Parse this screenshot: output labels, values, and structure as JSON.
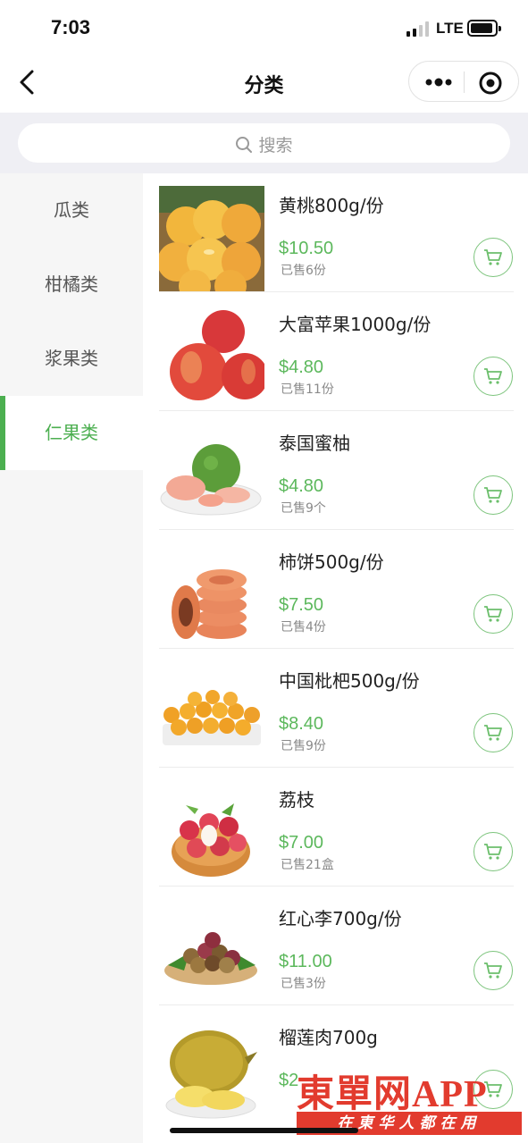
{
  "status_bar": {
    "time": "7:03",
    "network": "LTE"
  },
  "navbar": {
    "title": "分类"
  },
  "search": {
    "placeholder": "搜索"
  },
  "sidebar": {
    "items": [
      {
        "label": "瓜类",
        "active": false
      },
      {
        "label": "柑橘类",
        "active": false
      },
      {
        "label": "浆果类",
        "active": false
      },
      {
        "label": "仁果类",
        "active": true
      }
    ]
  },
  "products": [
    {
      "name": "黄桃800g/份",
      "price": "$10.50",
      "sold": "已售6份",
      "image": "yellow-peach"
    },
    {
      "name": "大富苹果1000g/份",
      "price": "$4.80",
      "sold": "已售11份",
      "image": "apple"
    },
    {
      "name": "泰国蜜柚",
      "price": "$4.80",
      "sold": "已售9个",
      "image": "pomelo"
    },
    {
      "name": "柿饼500g/份",
      "price": "$7.50",
      "sold": "已售4份",
      "image": "dried-persimmon"
    },
    {
      "name": "中国枇杷500g/份",
      "price": "$8.40",
      "sold": "已售9份",
      "image": "loquat"
    },
    {
      "name": "荔枝",
      "price": "$7.00",
      "sold": "已售21盒",
      "image": "lychee"
    },
    {
      "name": "红心李700g/份",
      "price": "$11.00",
      "sold": "已售3份",
      "image": "plum"
    },
    {
      "name": "榴莲肉700g",
      "price": "$2",
      "sold": "",
      "image": "durian"
    }
  ],
  "watermark": {
    "brand": "東單网APP",
    "slogan": "在東华人都在用"
  },
  "colors": {
    "accent": "#4caf50",
    "price": "#5cb85c",
    "watermark": "#e23b2e"
  }
}
